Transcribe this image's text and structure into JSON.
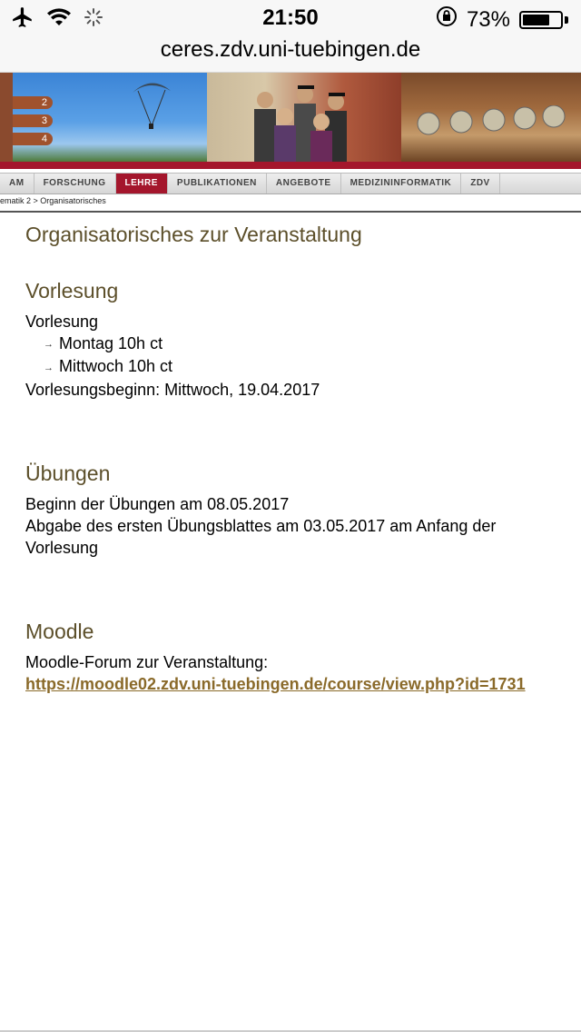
{
  "status": {
    "time": "21:50",
    "battery_text": "73%",
    "battery_level": 0.73
  },
  "browser": {
    "url": "ceres.zdv.uni-tuebingen.de"
  },
  "banner": {
    "sign_numbers": [
      "2",
      "3",
      "4"
    ]
  },
  "nav": {
    "tabs": [
      {
        "label": "AM"
      },
      {
        "label": "FORSCHUNG"
      },
      {
        "label": "LEHRE",
        "active": true
      },
      {
        "label": "PUBLIKATIONEN"
      },
      {
        "label": "ANGEBOTE"
      },
      {
        "label": "MEDIZININFORMATIK"
      },
      {
        "label": "ZDV"
      }
    ]
  },
  "breadcrumb": "ematik 2 > Organisatorisches",
  "page": {
    "title": "Organisatorisches zur Veranstaltung",
    "sections": {
      "vorlesung": {
        "heading": "Vorlesung",
        "intro": "Vorlesung",
        "items": [
          "Montag 10h ct",
          "Mittwoch 10h ct"
        ],
        "start": "Vorlesungsbeginn: Mittwoch, 19.04.2017"
      },
      "uebungen": {
        "heading": "Übungen",
        "line1": "Beginn der Übungen am 08.05.2017",
        "line2": "Abgabe des ersten Übungsblattes am 03.05.2017 am Anfang der Vorlesung"
      },
      "moodle": {
        "heading": "Moodle",
        "text": "Moodle-Forum zur Veranstaltung:",
        "link": "https://moodle02.zdv.uni-tuebingen.de/course/view.php?id=1731"
      }
    }
  }
}
